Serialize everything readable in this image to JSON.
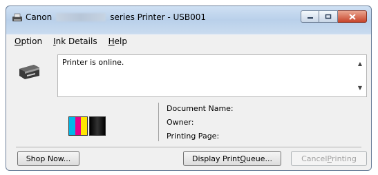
{
  "window": {
    "title_prefix": "Canon",
    "title_suffix": "series Printer - USB001",
    "controls": [
      "minimize-icon",
      "restore-icon",
      "close-icon"
    ]
  },
  "menu": {
    "option": {
      "accel": "O",
      "rest": "ption"
    },
    "ink_details": {
      "accel": "I",
      "rest": "nk Details"
    },
    "help": {
      "accel": "H",
      "rest": "elp"
    }
  },
  "status": {
    "text": "Printer is online."
  },
  "job": {
    "document_name_label": "Document Name:",
    "owner_label": "Owner:",
    "printing_page_label": "Printing Page:"
  },
  "ink": {
    "color_tank": [
      "#00b7e8",
      "#e6008a",
      "#ffe600"
    ],
    "black_tank": "#000000"
  },
  "buttons": {
    "shop_now": "Shop Now...",
    "display_queue_pre": "Display Print ",
    "display_queue_accel": "Q",
    "display_queue_post": "ueue...",
    "cancel_pre": "Cancel ",
    "cancel_accel": "P",
    "cancel_post": "rinting"
  }
}
